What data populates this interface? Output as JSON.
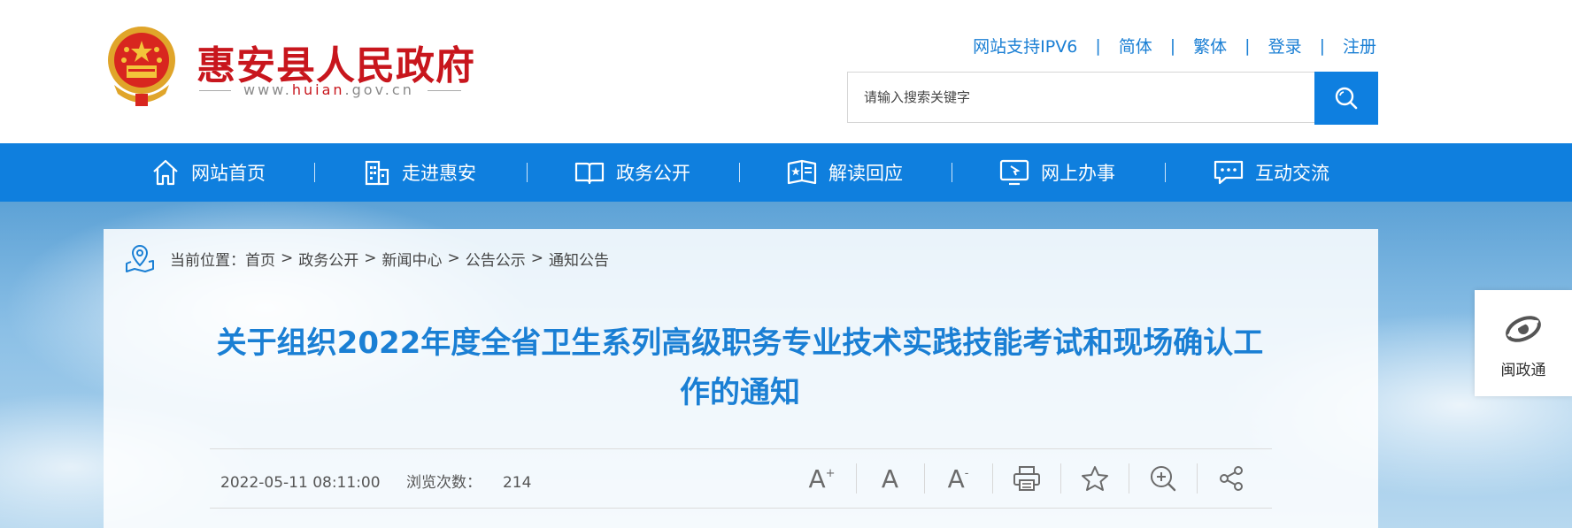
{
  "site": {
    "name": "惠安县人民政府",
    "domain_prefix": "www.",
    "domain_hl": "huian",
    "domain_suffix": ".gov.cn"
  },
  "toplinks": [
    "网站支持IPV6",
    "简体",
    "繁体",
    "登录",
    "注册"
  ],
  "search": {
    "placeholder": "请输入搜索关键字"
  },
  "nav": [
    {
      "label": "网站首页",
      "icon": "home-icon"
    },
    {
      "label": "走进惠安",
      "icon": "building-icon"
    },
    {
      "label": "政务公开",
      "icon": "book-icon"
    },
    {
      "label": "解读回应",
      "icon": "open-book-star-icon"
    },
    {
      "label": "网上办事",
      "icon": "monitor-icon"
    },
    {
      "label": "互动交流",
      "icon": "chat-icon"
    }
  ],
  "breadcrumb": {
    "prefix": "当前位置：",
    "items": [
      "首页",
      "政务公开",
      "新闻中心",
      "公告公示",
      "通知公告"
    ],
    "separator": ">"
  },
  "article": {
    "title": "关于组织2022年度全省卫生系列高级职务专业技术实践技能考试和现场确认工作的通知",
    "date": "2022-05-11 08:11:00",
    "views_label": "浏览次数：",
    "views": "214"
  },
  "tools": [
    "font-increase-icon",
    "font-normal-icon",
    "font-decrease-icon",
    "print-icon",
    "favorite-star-icon",
    "zoom-icon",
    "share-icon"
  ],
  "side_widget": {
    "label": "闽政通"
  },
  "colors": {
    "brand_red": "#c8161d",
    "brand_blue": "#0f7fde"
  }
}
